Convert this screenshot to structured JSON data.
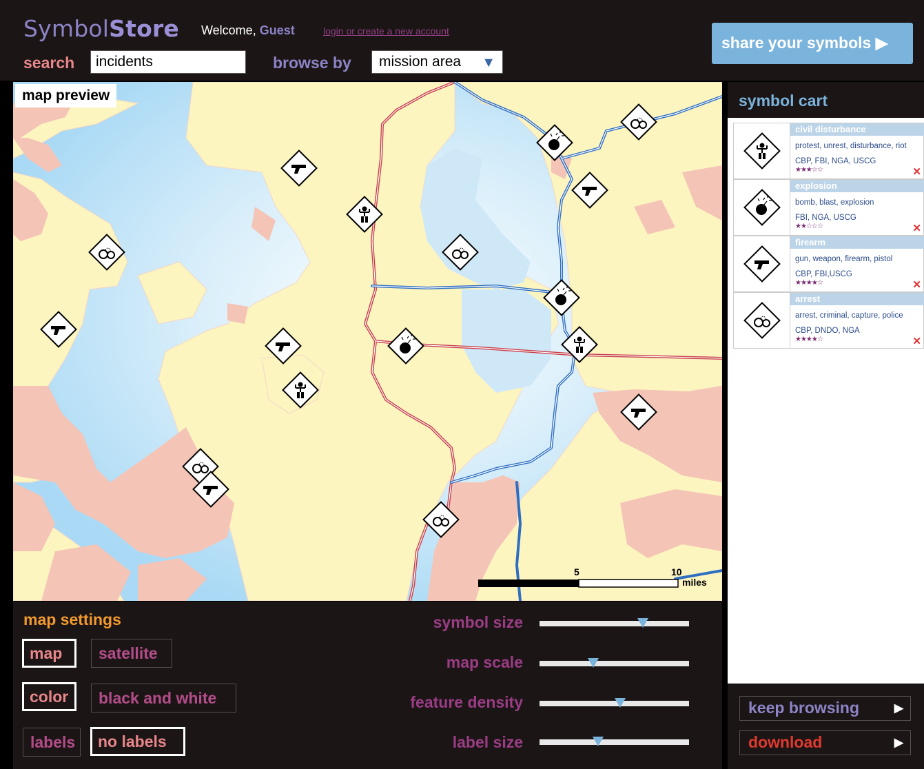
{
  "header": {
    "logo_part1": "Symbol",
    "logo_part2": "Store",
    "welcome_text": "Welcome,",
    "guest_name": "Guest",
    "login_link": "login or create a new account",
    "search_label": "search",
    "search_value": "incidents",
    "browse_label": "browse by",
    "browse_value": "mission area",
    "share_button": "share your symbols ▶"
  },
  "map": {
    "label": "map preview",
    "scale_5": "5",
    "scale_10": "10",
    "scale_unit": "miles",
    "colors": {
      "water": "#bfe3f7",
      "land": "#fdf5c0",
      "urban": "#f4c4b6",
      "highway_red": "#c8404a",
      "highway_blue": "#2f6fc2"
    }
  },
  "settings": {
    "title": "map settings",
    "map_type": [
      "map",
      "satellite"
    ],
    "color_mode": [
      "color",
      "black and white"
    ],
    "label_mode": [
      "labels",
      "no labels"
    ],
    "selected": {
      "map_type": "map",
      "color_mode": "color",
      "label_mode": "no labels"
    },
    "sliders": [
      {
        "label": "symbol size",
        "level": 0.69
      },
      {
        "label": "map scale",
        "level": 0.36
      },
      {
        "label": "feature density",
        "level": 0.54
      },
      {
        "label": "label size",
        "level": 0.39
      }
    ]
  },
  "cart": {
    "title": "symbol cart",
    "items": [
      {
        "name": "civil disturbance",
        "tags": "protest, unrest, disturbance, riot",
        "agencies": "CBP, FBI, NGA, USCG",
        "stars": "★★★☆☆",
        "icon": "civil-disturbance-icon",
        "remove": "✕"
      },
      {
        "name": "explosion",
        "tags": "bomb, blast, explosion",
        "agencies": "FBI, NGA, USCG",
        "stars": "★★☆☆☆",
        "icon": "explosion-icon",
        "remove": "✕"
      },
      {
        "name": "firearm",
        "tags": "gun, weapon, firearm, pistol",
        "agencies": "CBP, FBI,USCG",
        "stars": "★★★★☆",
        "icon": "firearm-icon",
        "remove": "✕"
      },
      {
        "name": "arrest",
        "tags": "arrest, criminal, capture, police",
        "agencies": "CBP, DNDO, NGA",
        "stars": "★★★★☆",
        "icon": "arrest-icon",
        "remove": "✕"
      }
    ],
    "keep_browsing": "keep browsing",
    "download": "download",
    "arrow": "▶"
  }
}
